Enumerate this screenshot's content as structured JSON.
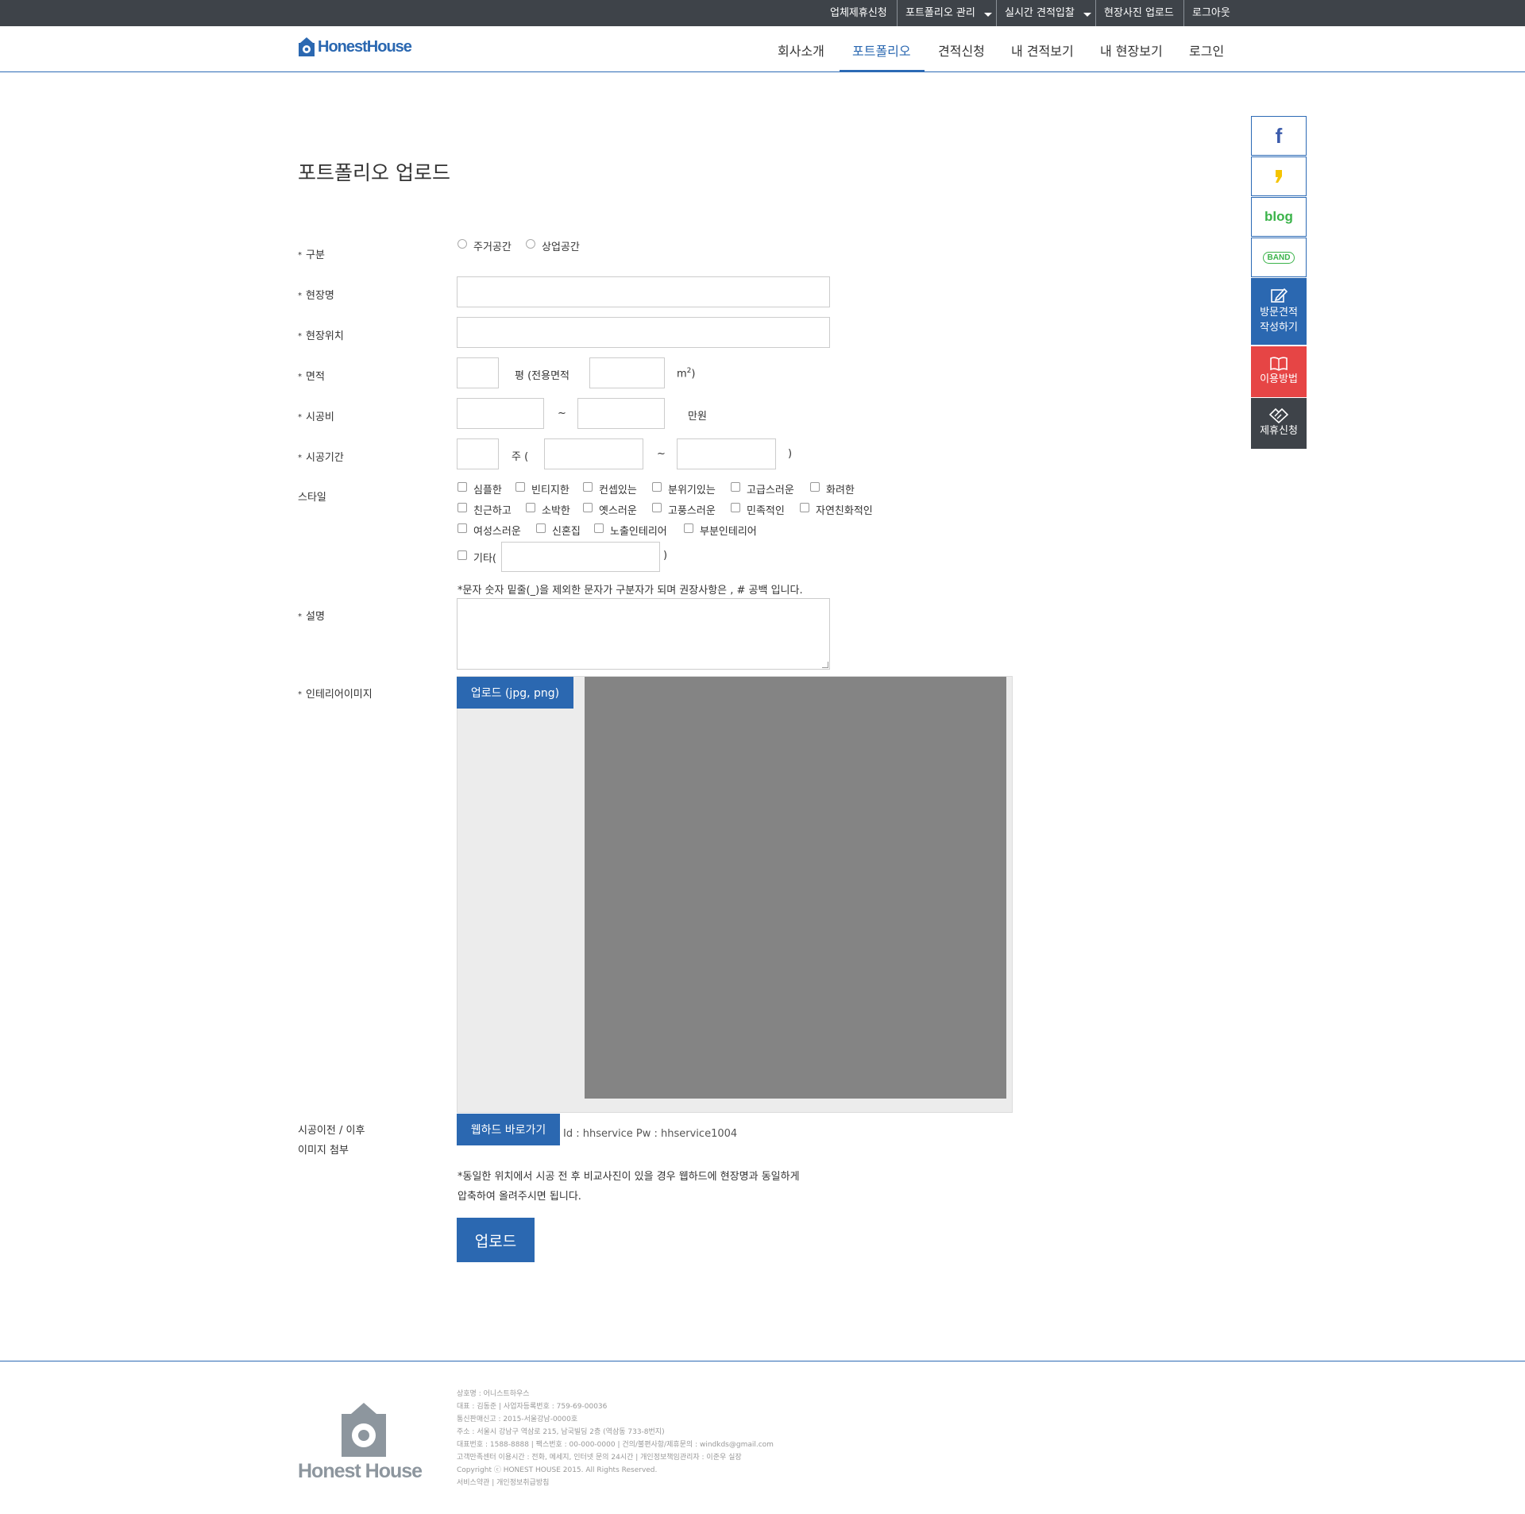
{
  "topbar": {
    "items": [
      "업체제휴신청",
      "포트폴리오 관리",
      "실시간 견적입찰",
      "현장사진 업로드",
      "로그아웃"
    ]
  },
  "header": {
    "logo_text": "HonestHouse",
    "nav": [
      "회사소개",
      "포트폴리오",
      "견적신청",
      "내 견적보기",
      "내 현장보기",
      "로그인"
    ],
    "active_nav": "포트폴리오"
  },
  "side": {
    "facebook": "f",
    "blog": "blog",
    "band": "BAND",
    "visit_1": "방문견적",
    "visit_2": "작성하기",
    "howto": "이용방법",
    "partner": "제휴신청"
  },
  "form": {
    "title": "포트폴리오 업로드",
    "category_label": "구분",
    "category_options": [
      "주거공간",
      "상업공간"
    ],
    "site_name_label": "현장명",
    "site_location_label": "현장위치",
    "area_label": "면적",
    "area_unit_pyeong": "평 (전용면적",
    "area_unit_m2": "m",
    "area_sup": "2",
    "area_close": ")",
    "cost_label": "시공비",
    "tilde": "~",
    "cost_unit": "만원",
    "period_label": "시공기간",
    "period_weeks": "주 (",
    "period_close": ")",
    "style_label": "스타일",
    "style_row1": [
      "심플한",
      "빈티지한",
      "컨셉있는",
      "분위기있는",
      "고급스러운",
      "화려한"
    ],
    "style_row2": [
      "친근하고",
      "소박한",
      "옛스러운",
      "고풍스러운",
      "민족적인",
      "자연친화적인"
    ],
    "style_row3": [
      "여성스러운",
      "신혼집",
      "노출인테리어",
      "부분인테리어"
    ],
    "style_other": "기타(",
    "style_other_close": ")",
    "tag_note": "*문자 숫자 밑줄(_)을 제외한 문자가 구분자가 되며 권장사항은 , # 공백 입니다.",
    "desc_label": "설명",
    "image_label": "인테리어이미지",
    "image_upload_button": "업로드 (jpg, png)",
    "before_after_label_1": "시공이전 / 이후",
    "before_after_label_2": "이미지 첨부",
    "webhard_button": "웹하드 바로가기",
    "webhard_credentials": "Id : hhservice Pw : hhservice1004",
    "webhard_note_1": "*동일한 위치에서 시공 전 후 비교사진이 있을 경우 웹하드에 현장명과 동일하게",
    "webhard_note_2": "압축하여 올려주시면 됩니다.",
    "submit_button": "업로드"
  },
  "footer": {
    "logo_text": "Honest House",
    "lines": [
      "상호명 : 어니스트하우스",
      "대표 : 김동준 | 사업자등록번호 : 759-69-00036",
      "통신판매신고 : 2015-서울강남-0000호",
      "주소 : 서울시 강남구 역삼로 215, 남국빌딩 2층 (역삼동 733-8번지)",
      "대표번호 : 1588-8888 | 팩스번호 : 00-000-0000 | 건의/불편사항/제휴문의 : windkds@gmail.com",
      "고객만족센터 이용시간 : 전화, 메세지, 인터넷 문의 24시간 | 개인정보책임관리자 : 이준우 실장",
      "Copyright ⓒ HONEST HOUSE 2015. All Rights Reserved.",
      "서비스약관 | 개인정보취급방침"
    ]
  },
  "colors": {
    "brand_blue": "#2b68b1",
    "topbar": "#3e4349",
    "howto_red": "#e64545",
    "partner_dark": "#3e4349"
  }
}
